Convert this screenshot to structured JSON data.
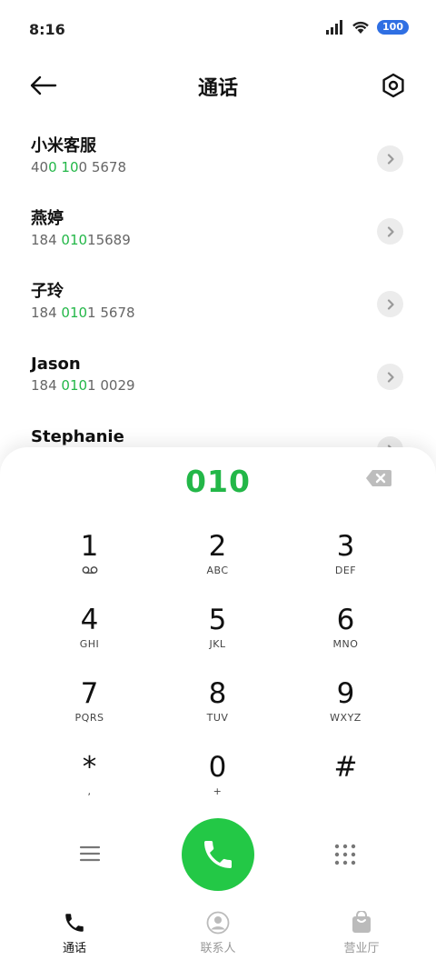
{
  "status": {
    "time": "8:16",
    "battery": "100"
  },
  "header": {
    "title": "通话"
  },
  "contacts": [
    {
      "name": "小米客服",
      "number_parts": [
        {
          "t": "40",
          "hl": false
        },
        {
          "t": "0",
          "hl": true
        },
        {
          "t": " ",
          "hl": false
        },
        {
          "t": "10",
          "hl": true
        },
        {
          "t": "0 5678",
          "hl": false
        }
      ]
    },
    {
      "name": "燕婷",
      "number_parts": [
        {
          "t": "184 ",
          "hl": false
        },
        {
          "t": "010",
          "hl": true
        },
        {
          "t": "15689",
          "hl": false
        }
      ]
    },
    {
      "name": "子玲",
      "number_parts": [
        {
          "t": "184 ",
          "hl": false
        },
        {
          "t": "010",
          "hl": true
        },
        {
          "t": "1 5678",
          "hl": false
        }
      ]
    },
    {
      "name": "Jason",
      "number_parts": [
        {
          "t": "184 ",
          "hl": false
        },
        {
          "t": "010",
          "hl": true
        },
        {
          "t": "1 0029",
          "hl": false
        }
      ]
    },
    {
      "name": "Stephanie",
      "number_parts": []
    }
  ],
  "dialer": {
    "input": "010",
    "keys": [
      {
        "digit": "1",
        "sub": "voicemail"
      },
      {
        "digit": "2",
        "sub": "ABC"
      },
      {
        "digit": "3",
        "sub": "DEF"
      },
      {
        "digit": "4",
        "sub": "GHI"
      },
      {
        "digit": "5",
        "sub": "JKL"
      },
      {
        "digit": "6",
        "sub": "MNO"
      },
      {
        "digit": "7",
        "sub": "PQRS"
      },
      {
        "digit": "8",
        "sub": "TUV"
      },
      {
        "digit": "9",
        "sub": "WXYZ"
      },
      {
        "digit": "*",
        "sub": ","
      },
      {
        "digit": "0",
        "sub": "+"
      },
      {
        "digit": "#",
        "sub": ""
      }
    ]
  },
  "nav": {
    "calls": "通话",
    "contacts": "联系人",
    "hall": "营业厅"
  },
  "colors": {
    "accent": "#23c846",
    "highlight": "#23b748",
    "battery": "#2f6fe3"
  }
}
